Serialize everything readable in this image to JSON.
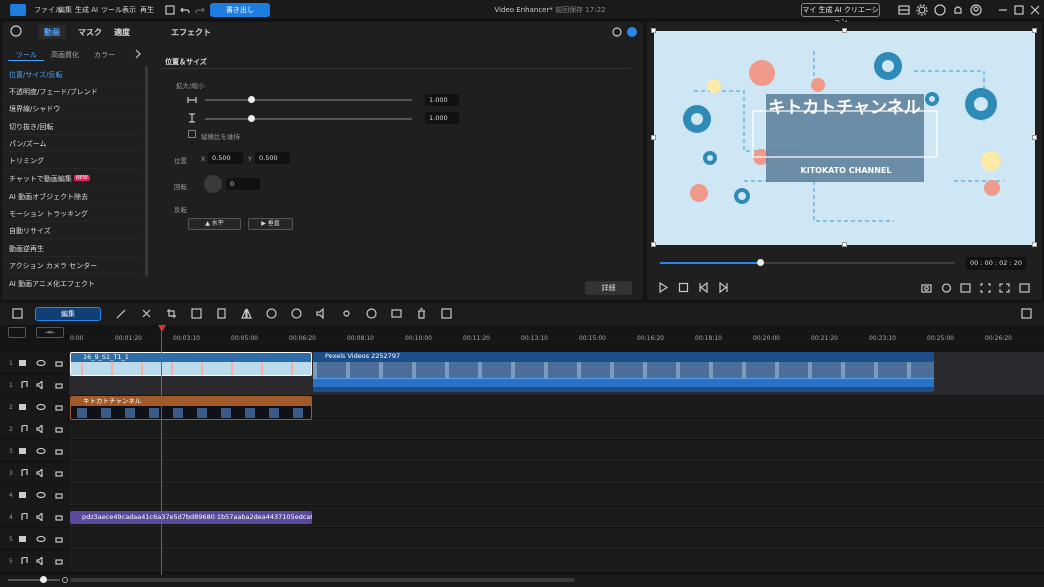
{
  "menu": {
    "file": "ファイル",
    "edit": "編集",
    "ai": "生成 AI",
    "tools": "ツール",
    "view": "表示",
    "play": "再生",
    "export": "書き出し"
  },
  "window": {
    "title": "Video Enhancer*",
    "saved": "前回保存 17:22",
    "ai_creation": "マイ 生成 AI クリエーション"
  },
  "left": {
    "tabs": [
      "動画",
      "マスク",
      "適度",
      "エフェクト"
    ],
    "subtabs": [
      "ツール",
      "高画質化",
      "カラー"
    ],
    "features": [
      "位置/サイズ/反転",
      "不透明度/フェード/ブレンド",
      "境界線/シャドウ",
      "切り抜き/回転",
      "パン/ズーム",
      "トリミング",
      "チャットで動画編集",
      "AI 動画オブジェクト除去",
      "モーション トラッキング",
      "自動リサイズ",
      "動画逆再生",
      "アクション カメラ センター",
      "AI 動画アニメ化エフェクト"
    ],
    "new_badge": "NEW",
    "section_title": "位置＆サイズ",
    "scale_label": "拡大/縮小",
    "scale_w": "1.000",
    "scale_h": "1.000",
    "scale_fraction": 0.22,
    "keep_ratio": "縦横比を維持",
    "position_label": "位置",
    "x_label": "X",
    "x_val": "0.500",
    "y_label": "Y",
    "y_val": "0.500",
    "rotate_label": "回転",
    "rotate_val": "0",
    "flip_label": "反転",
    "flip_h": "水平",
    "flip_v": "垂直",
    "detail": "詳細"
  },
  "preview": {
    "title_text": "キトカトチャンネル",
    "sub_text": "KITOKATO CHANNEL",
    "timecode": "00 : 00 : 02 : 20",
    "progress": 0.34
  },
  "timeline": {
    "edit": "編集",
    "ticks": [
      "0:00",
      "00:01:20",
      "00:03:10",
      "00:05:00",
      "00:06:20",
      "00:08:10",
      "00:10:00",
      "00:11:20",
      "00:13:10",
      "00:15:00",
      "00:16:20",
      "00:18:10",
      "00:20:00",
      "00:21:20",
      "00:23:10",
      "00:25:00",
      "00:26:20"
    ],
    "track_nums": [
      "1",
      "1",
      "2",
      "2",
      "3",
      "3",
      "4",
      "4",
      "5",
      "5"
    ],
    "clip1": "16_9_S1_T1_1",
    "clip2": "Pexels Videos 2252797",
    "clip3": "キトカトチャンネル",
    "clip4": "pdz3aece49cadaa41c6a37e5d7bd89680 1b57aaba2dea4437105edca06266e4880"
  }
}
